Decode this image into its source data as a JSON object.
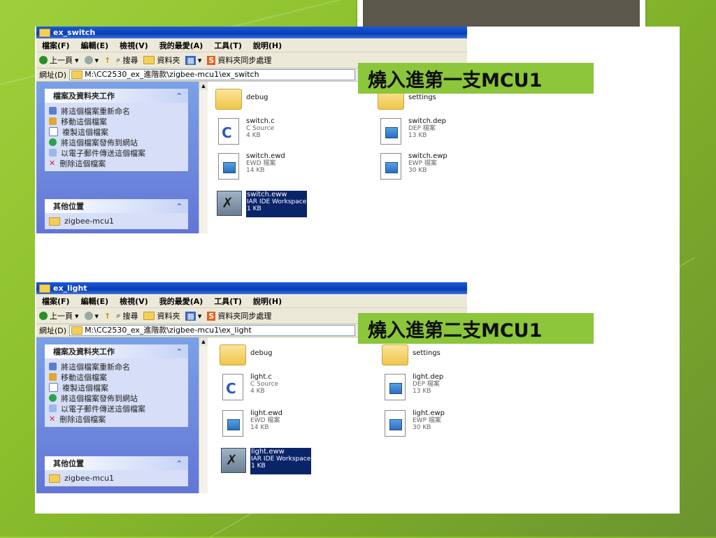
{
  "windows": [
    {
      "title": "ex_switch",
      "menu": [
        "檔案(F)",
        "編輯(E)",
        "檢視(V)",
        "我的最愛(A)",
        "工具(T)",
        "說明(H)"
      ],
      "toolbar": {
        "back": "上一頁",
        "search": "搜尋",
        "folders": "資料夾",
        "sync": "資料夾同步處理"
      },
      "address_label": "網址(D)",
      "address": "M:\\CC2530_ex_進階款\\zigbee-mcu1\\ex_switch",
      "tasks_title": "檔案及資料夾工作",
      "tasks": [
        "將這個檔案重新命名",
        "移動這個檔案",
        "複製這個檔案",
        "將這個檔案發佈到網站",
        "以電子郵件傳送這個檔案",
        "刪除這個檔案"
      ],
      "other_title": "其他位置",
      "other": [
        "zigbee-mcu1"
      ],
      "files": [
        {
          "name": "debug",
          "type": "",
          "size": "",
          "icon": "folder-icon"
        },
        {
          "name": "settings",
          "type": "",
          "size": "",
          "icon": "folder-icon"
        },
        {
          "name": "switch.c",
          "type": "C Source",
          "size": "4 KB",
          "icon": "c-source-icon"
        },
        {
          "name": "switch.dep",
          "type": "DEP 檔案",
          "size": "13 KB",
          "icon": "file-icon"
        },
        {
          "name": "switch.ewd",
          "type": "EWD 檔案",
          "size": "14 KB",
          "icon": "file-icon"
        },
        {
          "name": "switch.ewp",
          "type": "EWP 檔案",
          "size": "30 KB",
          "icon": "file-icon"
        },
        {
          "name": "switch.eww",
          "type": "IAR IDE Workspace",
          "size": "1 KB",
          "icon": "workspace-icon",
          "selected": true
        }
      ],
      "callout": "燒入進第一支MCU1"
    },
    {
      "title": "ex_light",
      "menu": [
        "檔案(F)",
        "編輯(E)",
        "檢視(V)",
        "我的最愛(A)",
        "工具(T)",
        "說明(H)"
      ],
      "toolbar": {
        "back": "上一頁",
        "search": "搜尋",
        "folders": "資料夾",
        "sync": "資料夾同步處理"
      },
      "address_label": "網址(D)",
      "address": "M:\\CC2530_ex_進階款\\zigbee-mcu1\\ex_light",
      "tasks_title": "檔案及資料夾工作",
      "tasks": [
        "將這個檔案重新命名",
        "移動這個檔案",
        "複製這個檔案",
        "將這個檔案發佈到網站",
        "以電子郵件傳送這個檔案",
        "刪除這個檔案"
      ],
      "other_title": "其他位置",
      "other": [
        "zigbee-mcu1"
      ],
      "files": [
        {
          "name": "debug",
          "type": "",
          "size": "",
          "icon": "folder-icon"
        },
        {
          "name": "settings",
          "type": "",
          "size": "",
          "icon": "folder-icon"
        },
        {
          "name": "light.c",
          "type": "C Source",
          "size": "4 KB",
          "icon": "c-source-icon"
        },
        {
          "name": "light.dep",
          "type": "DEP 檔案",
          "size": "13 KB",
          "icon": "file-icon"
        },
        {
          "name": "light.ewd",
          "type": "EWD 檔案",
          "size": "14 KB",
          "icon": "file-icon"
        },
        {
          "name": "light.ewp",
          "type": "EWP 檔案",
          "size": "30 KB",
          "icon": "file-icon"
        },
        {
          "name": "light.eww",
          "type": "IAR IDE Workspace",
          "size": "1 KB",
          "icon": "workspace-icon",
          "selected": true
        }
      ],
      "callout": "燒入進第二支MCU1"
    }
  ],
  "colors": {
    "callout": "#8bc63b",
    "selection": "#0a246a",
    "titlebar": "#0a3cb5"
  }
}
